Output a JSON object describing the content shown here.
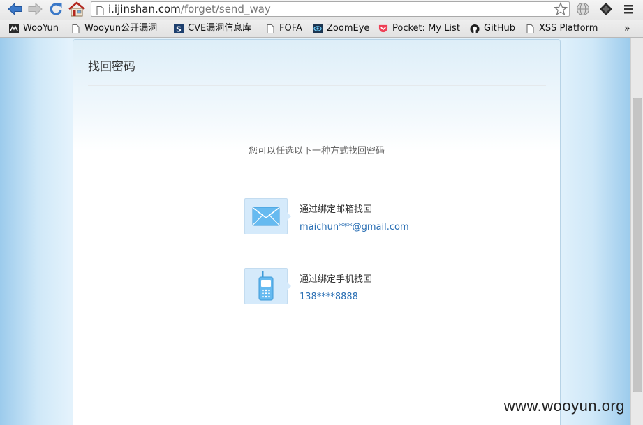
{
  "browser": {
    "url_host": "i.ijinshan.com",
    "url_path": "/forget/send_way"
  },
  "bookmarks": [
    {
      "label": "WooYun",
      "icon": "wooyun-icon"
    },
    {
      "label": "Wooyun公开漏洞",
      "icon": "page-icon"
    },
    {
      "label": "CVE漏洞信息库",
      "icon": "cve-s-icon"
    },
    {
      "label": "FOFA",
      "icon": "page-icon"
    },
    {
      "label": "ZoomEye",
      "icon": "zoomeye-eye-icon"
    },
    {
      "label": "Pocket: My List",
      "icon": "pocket-icon"
    },
    {
      "label": "GitHub",
      "icon": "github-icon"
    },
    {
      "label": "XSS Platform",
      "icon": "page-icon"
    }
  ],
  "bookmarks_overflow": "»",
  "page": {
    "title": "找回密码",
    "subtitle": "您可以任选以下一种方式找回密码",
    "methods": [
      {
        "label": "通过绑定邮箱找回",
        "value": "maichun***@gmail.com",
        "icon": "envelope-icon"
      },
      {
        "label": "通过绑定手机找回",
        "value": "138****8888",
        "icon": "mobile-phone-icon"
      }
    ]
  },
  "watermark": "www.wooyun.org",
  "colors": {
    "link": "#2a6fb4",
    "tile_bg": "#d5eafb",
    "page_bg_side": "#9ccbec",
    "pocket": "#ee4056"
  }
}
